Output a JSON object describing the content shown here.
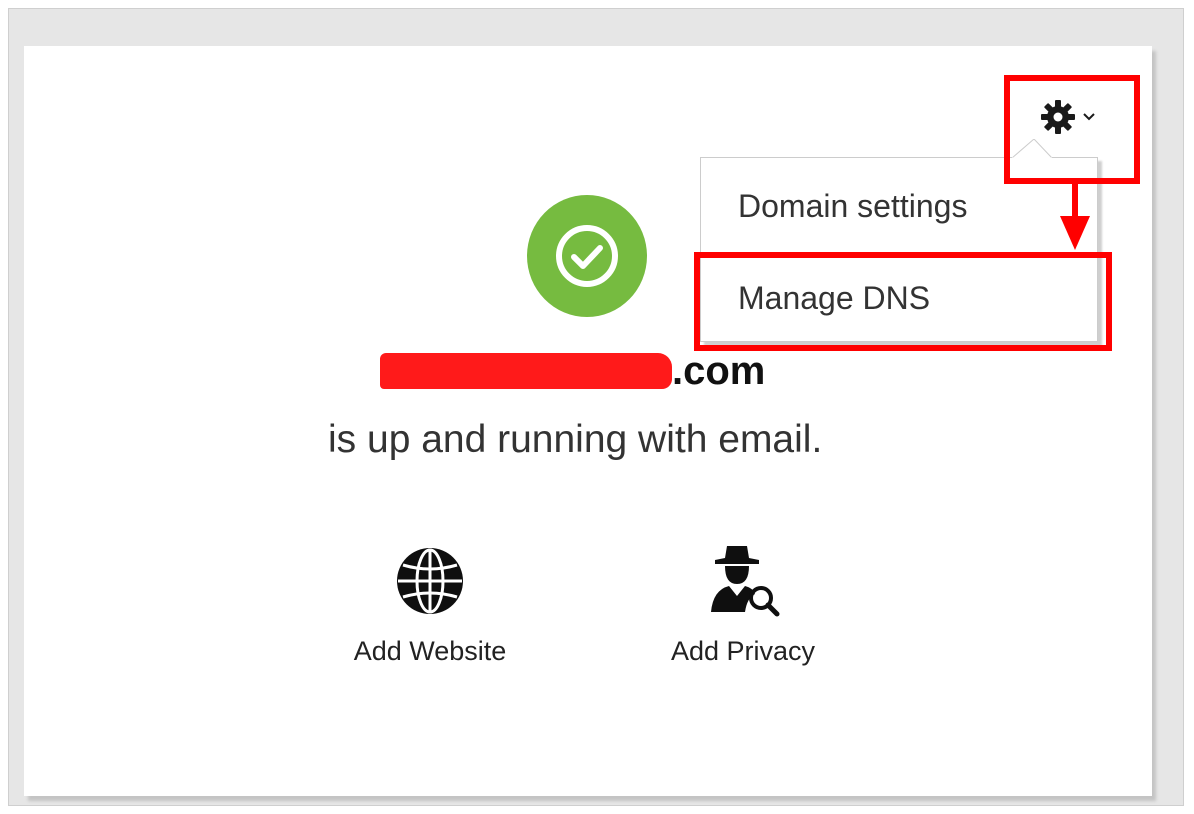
{
  "menu": {
    "items": [
      {
        "label": "Domain settings"
      },
      {
        "label": "Manage DNS"
      }
    ]
  },
  "domain": {
    "suffix": ".com",
    "status_text": "is up and running with email."
  },
  "actions": [
    {
      "label": "Add Website",
      "icon": "globe-icon"
    },
    {
      "label": "Add Privacy",
      "icon": "spy-search-icon"
    }
  ],
  "colors": {
    "status_green": "#76bb40",
    "annotation_red": "#ff0000",
    "redaction_red": "#ff1a1a"
  },
  "icons": {
    "menu_trigger": "gear-icon",
    "menu_caret": "chevron-down-icon",
    "status": "check-circle-icon"
  }
}
